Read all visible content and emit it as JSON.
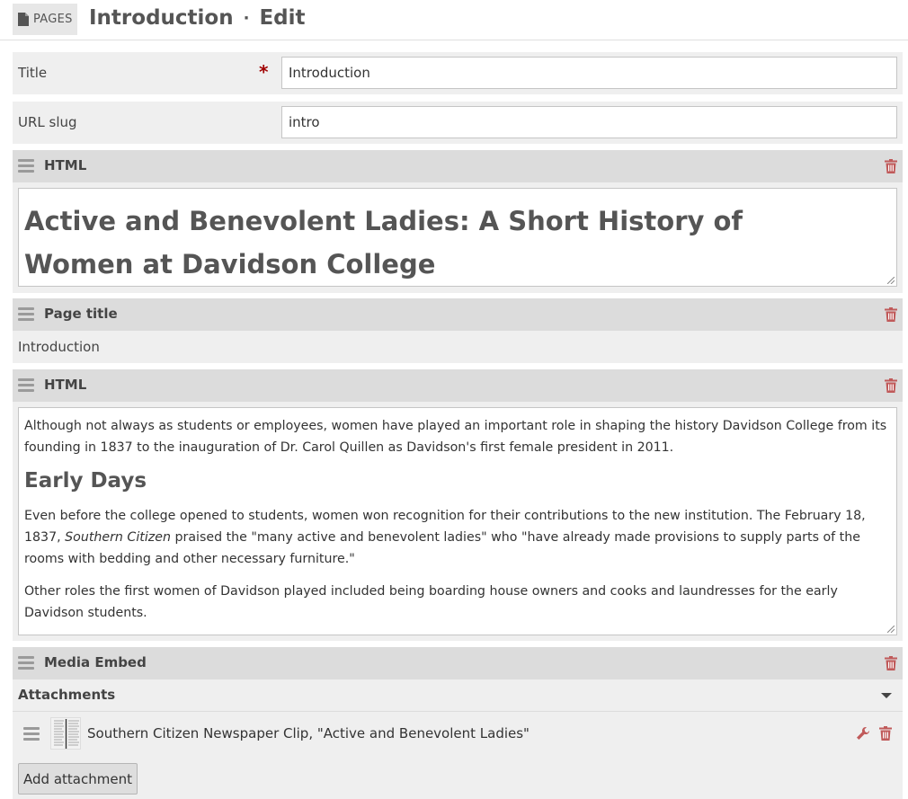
{
  "header": {
    "pages_label": "PAGES",
    "page_name": "Introduction",
    "separator": "·",
    "mode": "Edit"
  },
  "fields": {
    "title_label": "Title",
    "title_required_mark": "*",
    "title_value": "Introduction",
    "slug_label": "URL slug",
    "slug_value": "intro"
  },
  "blocks": [
    {
      "type_label": "HTML",
      "content_heading": "Active and Benevolent Ladies: A Short History of Women at Davidson College"
    },
    {
      "type_label": "Page title",
      "value": "Introduction"
    },
    {
      "type_label": "HTML",
      "p1": "Although not always as students or employees, women have played an important role in shaping the history Davidson College from its founding in 1837 to the inauguration of Dr. Carol Quillen as Davidson's first female president in 2011.",
      "h2": "Early Days",
      "p2_before": "Even before the college opened to students, women won recognition for their contributions to the new institution. The February 18, 1837, ",
      "p2_italic": "Southern Citizen",
      "p2_after": "  praised the \"many active and benevolent ladies\" who \"have already made provisions to supply parts of the rooms with bedding and other necessary furniture.\"",
      "p3": "Other roles the first women of Davidson played included being boarding house owners and cooks and laundresses for the early Davidson students."
    },
    {
      "type_label": "Media Embed",
      "attachments_label": "Attachments",
      "attachment_title": "Southern Citizen Newspaper Clip, \"Active and Benevolent Ladies\"",
      "add_attachment_label": "Add attachment"
    }
  ],
  "icons": {
    "pages": "document-icon",
    "drag": "drag-handle-icon",
    "delete": "trash-icon",
    "edit": "wrench-icon",
    "expand": "caret-down-icon"
  },
  "colors": {
    "required": "#a00000",
    "delete": "#c05a5a",
    "header_bar": "#dcdcdc",
    "panel": "#efefef"
  }
}
